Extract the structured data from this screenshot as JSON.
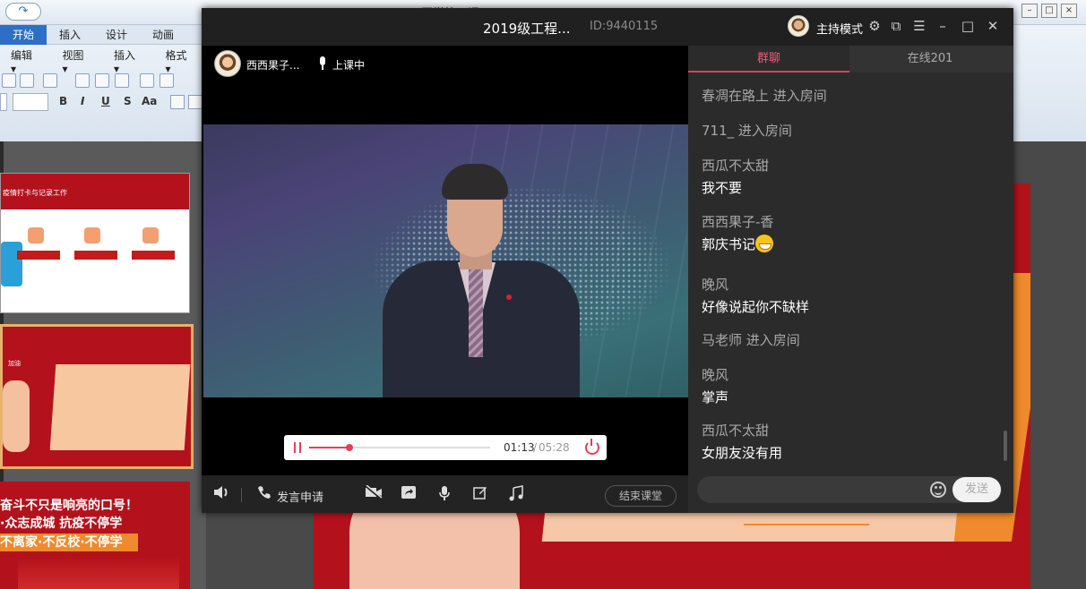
{
  "ppt": {
    "title": "开学第一课 - Microsoft PowerPoint",
    "tabs": [
      "开始",
      "插入",
      "设计",
      "动画"
    ],
    "row2": [
      "编辑 ▾",
      "视图 ▾",
      "插入 ▾",
      "格式 ▾"
    ],
    "format_buttons": [
      "B",
      "I",
      "U",
      "S",
      "Aa"
    ],
    "thumb1_title": "疫情打卡与记录工作",
    "thumb2_title": "加油",
    "thumb3_line1": "奋斗不只是响亮的口号！",
    "thumb3_line2": "·众志成城 抗疫不停学",
    "thumb3_line3": "不离家·不反校·不停学"
  },
  "window": {
    "title": "2019级工程...",
    "room_id": "ID:9440115",
    "host_mode_label": "主持模式"
  },
  "video": {
    "teacher_name": "西西果子...",
    "status": "上课中",
    "current_time": "01:13",
    "separator": "/",
    "total_time": "05:28",
    "progress": 0.223
  },
  "bottom_bar": {
    "speak_request": "发言申请",
    "end_class": "结束课堂"
  },
  "chat": {
    "tab_group": "群聊",
    "tab_online": "在线201",
    "messages": {
      "m1": "春凋在路上 进入房间",
      "m2": "711_ 进入房间",
      "m3_name": "西瓜不太甜",
      "m3_text": "我不要",
      "m4_name": "西西果子-香",
      "m4_text": "郭庆书记",
      "m5_name": "晚风",
      "m5_text": "好像说起你不缺样",
      "m6": "马老师 进入房间",
      "m7_name": "晚风",
      "m7_text": "掌声",
      "m8_name": "西瓜不太甜",
      "m8_text": "女朋友没有用"
    },
    "input_placeholder": "",
    "send_label": "发送"
  },
  "colors": {
    "accent": "#e2405a",
    "window_bg": "#1e1e1e",
    "chat_bg": "#2b2b2b",
    "slide_red": "#b3121c",
    "slide_orange": "#f08a2c"
  },
  "icons": {
    "volume": "speaker-icon",
    "phone": "phone-icon",
    "camera_off": "camera-off-icon",
    "share": "share-screen-icon",
    "mic": "microphone-icon",
    "edit": "edit-icon",
    "music": "music-icon"
  }
}
